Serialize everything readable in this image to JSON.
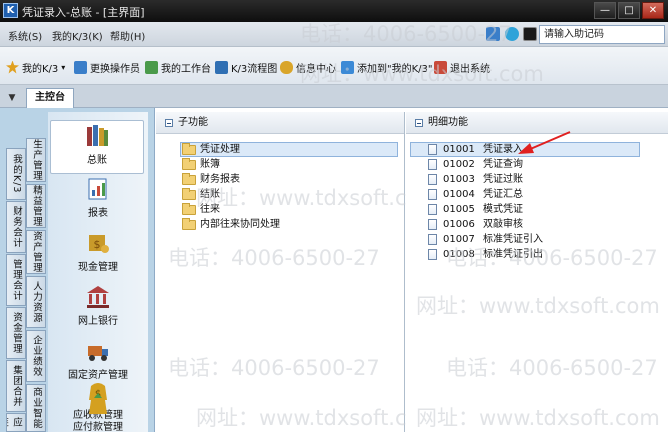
{
  "window": {
    "title": "凭证录入-总账 - [主界面]",
    "logo": "K"
  },
  "menu": {
    "items": [
      "系统(S)",
      "我的K/3(K)",
      "帮助(H)"
    ],
    "search_placeholder": "请输入助记码"
  },
  "toolbar": {
    "items": [
      {
        "label": "我的K/3",
        "icon": "star-icon",
        "color": "#e0a020"
      },
      {
        "label": "更换操作员",
        "icon": "user-switch-icon",
        "color": "#3a7ec9"
      },
      {
        "label": "我的工作台",
        "icon": "workbench-icon",
        "color": "#4a9a4a"
      },
      {
        "label": "K/3流程图",
        "icon": "flowchart-icon",
        "color": "#2f6fb3"
      },
      {
        "label": "信息中心",
        "icon": "message-icon",
        "color": "#d9a52a"
      },
      {
        "label": "添加到\"我的K/3\"",
        "icon": "add-favorite-icon",
        "color": "#3c8ad6"
      },
      {
        "label": "退出系统",
        "icon": "exit-icon",
        "color": "#c94a3a"
      }
    ]
  },
  "tabs": {
    "main": "主控台"
  },
  "sidebar": {
    "tabs": [
      "我的K/3",
      "财务会计",
      "管理会计",
      "资金管理",
      "集团合并",
      "供应链",
      "生产管理",
      "精益管理",
      "资产管理",
      "人力资源",
      "企业绩效",
      "商业智能"
    ]
  },
  "modules": [
    {
      "label": "总账",
      "icon": "ledger-books-icon",
      "color": "#9b3a3a"
    },
    {
      "label": "报表",
      "icon": "report-icon",
      "color": "#3b6fb0"
    },
    {
      "label": "现金管理",
      "icon": "cash-icon",
      "color": "#c99a2a"
    },
    {
      "label": "网上银行",
      "icon": "online-bank-icon",
      "color": "#b04040"
    },
    {
      "label": "固定资产管理",
      "icon": "fixed-asset-icon",
      "color": "#c76b2a"
    },
    {
      "label": "应收款管理",
      "icon": "receivable-icon",
      "color": "#d4a020"
    },
    {
      "label": "应付款管理",
      "icon": "payable-icon",
      "color": "#d4a020"
    }
  ],
  "subpanel": {
    "title": "子功能",
    "items": [
      "凭证处理",
      "账簿",
      "财务报表",
      "结账",
      "往来",
      "内部往来协同处理"
    ]
  },
  "detailpanel": {
    "title": "明细功能",
    "items": [
      {
        "code": "01001",
        "label": "凭证录入"
      },
      {
        "code": "01002",
        "label": "凭证查询"
      },
      {
        "code": "01003",
        "label": "凭证过账"
      },
      {
        "code": "01004",
        "label": "凭证汇总"
      },
      {
        "code": "01005",
        "label": "模式凭证"
      },
      {
        "code": "01006",
        "label": "双敲审核"
      },
      {
        "code": "01007",
        "label": "标准凭证引入"
      },
      {
        "code": "01008",
        "label": "标准凭证引出"
      }
    ]
  },
  "watermark": {
    "phone": "电话：4006-6500-27",
    "site": "网址：www.tdxsoft.com"
  },
  "colors": {
    "arrow": "#e02020",
    "accent": "#1f5fae"
  }
}
